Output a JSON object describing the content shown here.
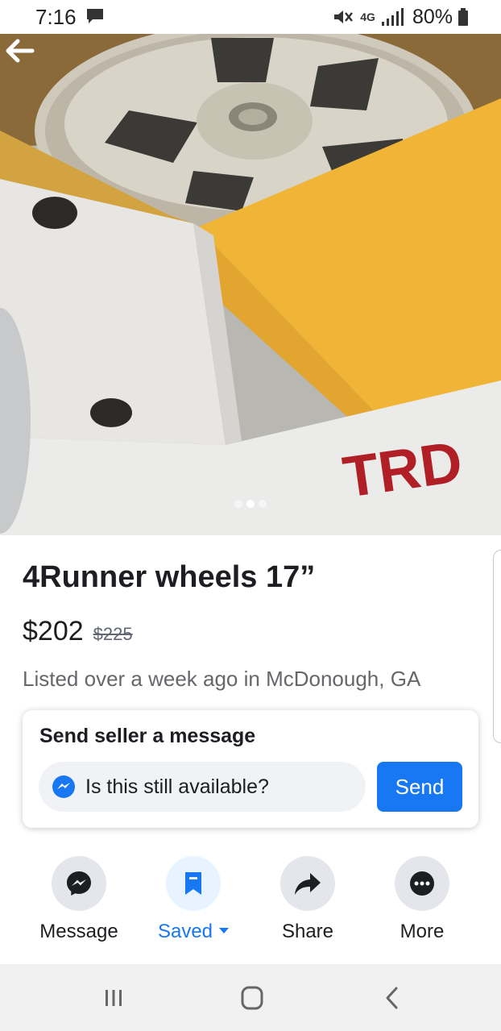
{
  "status_bar": {
    "time": "7:16",
    "network": "4G",
    "battery": "80%"
  },
  "photo": {
    "brand_text": "TRD",
    "image_count": 3,
    "active_index": 1
  },
  "listing": {
    "title": "4Runner wheels 17”",
    "price": "$202",
    "original_price": "$225",
    "listed_text": "Listed over a week ago in McDonough, GA"
  },
  "message_card": {
    "heading": "Send seller a message",
    "input_value": "Is this still available?",
    "send_label": "Send"
  },
  "actions": [
    {
      "label": "Message",
      "icon": "messenger-icon"
    },
    {
      "label": "Saved",
      "icon": "bookmark-icon"
    },
    {
      "label": "Share",
      "icon": "share-icon"
    },
    {
      "label": "More",
      "icon": "more-icon"
    }
  ],
  "colors": {
    "accent": "#1877f2",
    "saved_bg": "#e7f3ff",
    "circle_bg": "#e4e6eb",
    "input_bg": "#f0f2f5",
    "secondary_text": "#65676b",
    "nav_bg": "#f1f1f1"
  }
}
